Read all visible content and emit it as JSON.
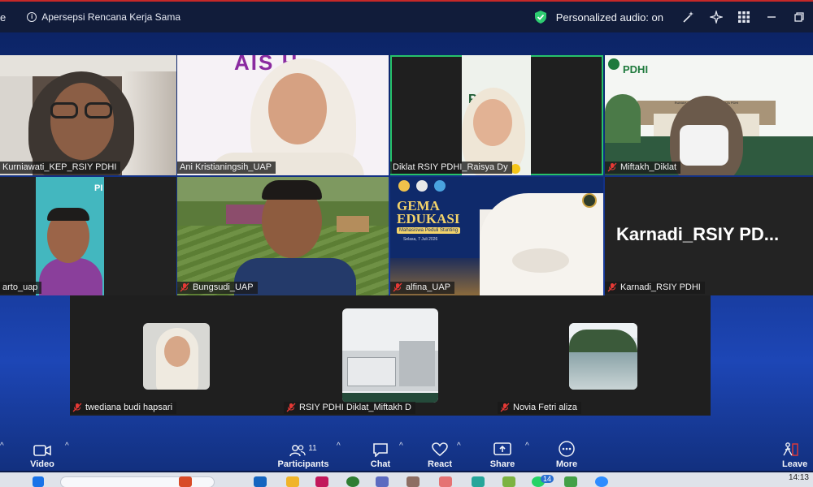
{
  "window": {
    "title_fragment": "e",
    "meeting_topic": "Apersepsi Rencana Kerja Sama",
    "audio_status": "Personalized audio: on"
  },
  "gallery": {
    "tiles": [
      {
        "name": "Kurniawati_KEP_RSIY PDHI",
        "muted": false
      },
      {
        "name": "Ani Kristianingsih_UAP",
        "muted": false
      },
      {
        "name": "Diklat RSIY PDHI_Raisya Dy",
        "muted": false,
        "active": true
      },
      {
        "name": "Miftakh_Diklat",
        "muted": true
      },
      {
        "name": "arto_uap",
        "muted": false
      },
      {
        "name": "Bungsudi_UAP",
        "muted": true
      },
      {
        "name": "alfina_UAP",
        "muted": true
      },
      {
        "name": "Karnadi_RSIY PDHI",
        "muted": true
      }
    ],
    "camera_off_banner": "Karnadi_RSIY  PD...",
    "background_texts": {
      "ani_banner": "AIS   H",
      "gema_title_1": "GEMA",
      "gema_title_2": "EDUKASI",
      "gema_subtitle": "Mahasiswa Peduli Stunting",
      "gema_date": "Selasa, 7 Juli 2026",
      "miftakh_logo": "PDHI",
      "miftakh_building": "RUMAH SAKIT ISLAM YOGYAKARTA PDHI",
      "arto_corner": "PI",
      "raisya_banner": "PDHI"
    }
  },
  "gallery2": {
    "tiles": [
      {
        "name": "twediana budi hapsari",
        "muted": true
      },
      {
        "name": "RSIY PDHI Diklat_Miftakh D",
        "muted": true
      },
      {
        "name": "Novia Fetri aliza",
        "muted": true
      }
    ]
  },
  "toolbar": {
    "video": "Video",
    "participants": "Participants",
    "participants_count": "11",
    "chat": "Chat",
    "react": "React",
    "share": "Share",
    "more": "More",
    "leave": "Leave"
  },
  "taskbar": {
    "clock": "14:13",
    "badge": "14"
  },
  "colors": {
    "stage_top": "#0c2466",
    "stage_bottom": "#1d46b6",
    "active_speaker": "#27c26a",
    "mute_red": "#e53935",
    "toolbar_bg": "#1d46b6"
  }
}
